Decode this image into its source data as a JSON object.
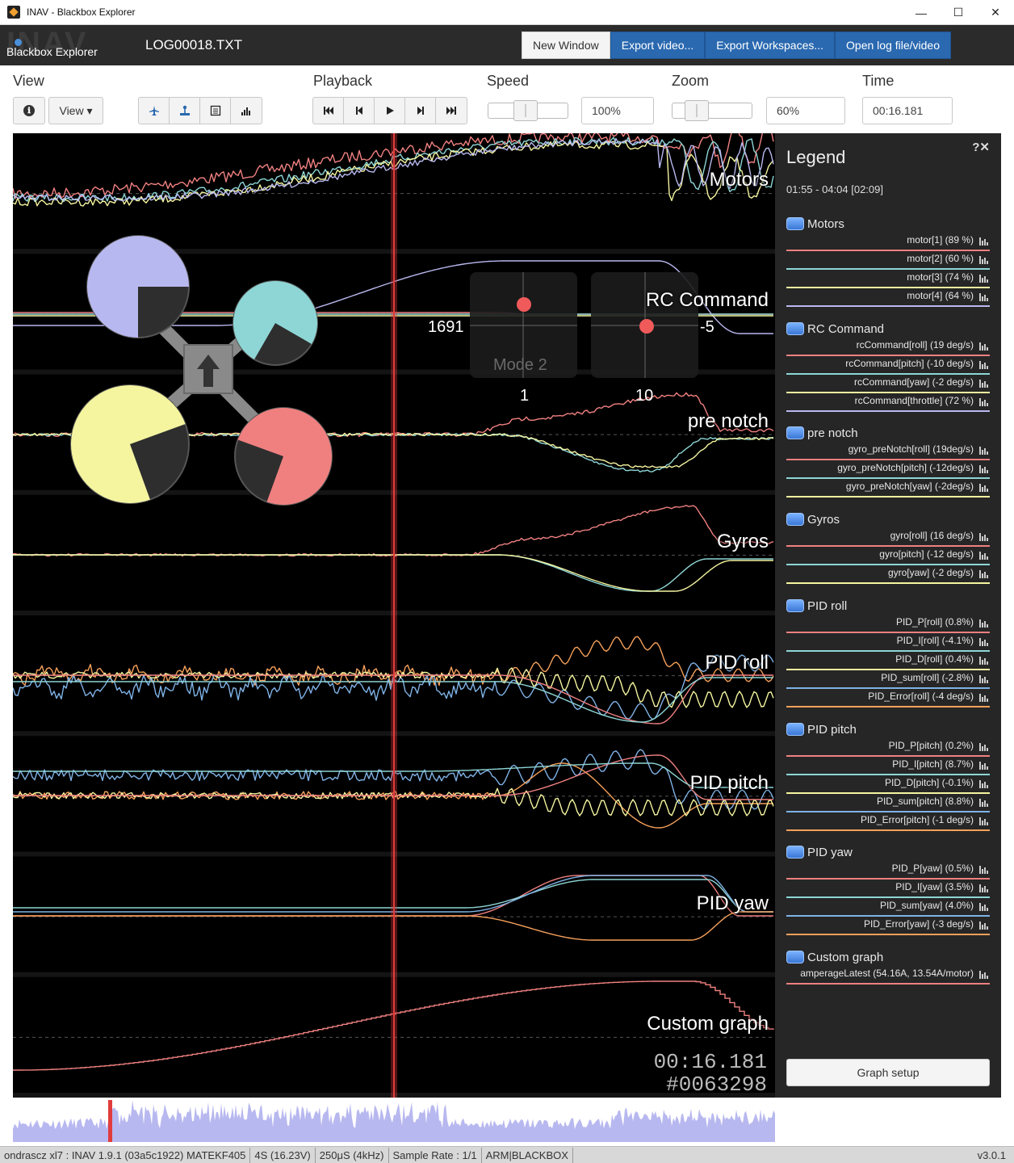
{
  "window": {
    "title": "INAV - Blackbox Explorer",
    "minimize": "—",
    "maximize": "☐",
    "close": "✕"
  },
  "header": {
    "logo_text": "INAV",
    "logo_sub": "Blackbox Explorer",
    "filename": "LOG00018.TXT",
    "buttons": {
      "new_window": "New Window",
      "export_video": "Export video...",
      "export_workspaces": "Export Workspaces...",
      "open_log": "Open log file/video"
    }
  },
  "toolbar": {
    "view_label": "View",
    "info_icon": "ℹ",
    "view_button": "View ▾",
    "playback_label": "Playback",
    "speed_label": "Speed",
    "speed_value": "100%",
    "speed_fraction": 0.45,
    "zoom_label": "Zoom",
    "zoom_value": "60%",
    "zoom_fraction": 0.22,
    "time_label": "Time",
    "time_value": "00:16.181"
  },
  "graph": {
    "labels": {
      "motors": "Motors",
      "rc": "RC Command",
      "prenotch": "pre notch",
      "gyros": "Gyros",
      "pidroll": "PID roll",
      "pidpitch": "PID pitch",
      "pidyaw": "PID yaw",
      "custom": "Custom graph"
    },
    "sticks": {
      "left_value": "1691",
      "right_value": "-5",
      "left_bottom": "1",
      "right_bottom": "10",
      "mode": "Mode 2"
    },
    "time": "00:16.181",
    "frame": "#0063298"
  },
  "legend": {
    "title": "Legend",
    "close_icons": "?✕",
    "range": "01:55 - 04:04 [02:09]",
    "groups": [
      {
        "name": "Motors",
        "items": [
          {
            "label": "motor[1] (89 %)",
            "color": "#f08080"
          },
          {
            "label": "motor[2] (60 %)",
            "color": "#8ed6d6"
          },
          {
            "label": "motor[3] (74 %)",
            "color": "#f5f5a0"
          },
          {
            "label": "motor[4] (64 %)",
            "color": "#b8b8f0"
          }
        ]
      },
      {
        "name": "RC Command",
        "items": [
          {
            "label": "rcCommand[roll] (19 deg/s)",
            "color": "#f08080"
          },
          {
            "label": "rcCommand[pitch] (-10 deg/s)",
            "color": "#8ed6d6"
          },
          {
            "label": "rcCommand[yaw] (-2 deg/s)",
            "color": "#f5f5a0"
          },
          {
            "label": "rcCommand[throttle] (72 %)",
            "color": "#b8b8f0"
          }
        ]
      },
      {
        "name": "pre notch",
        "items": [
          {
            "label": "gyro_preNotch[roll] (19deg/s)",
            "color": "#f08080"
          },
          {
            "label": "gyro_preNotch[pitch] (-12deg/s)",
            "color": "#8ed6d6"
          },
          {
            "label": "gyro_preNotch[yaw] (-2deg/s)",
            "color": "#f5f5a0"
          }
        ]
      },
      {
        "name": "Gyros",
        "items": [
          {
            "label": "gyro[roll] (16 deg/s)",
            "color": "#f08080"
          },
          {
            "label": "gyro[pitch] (-12 deg/s)",
            "color": "#8ed6d6"
          },
          {
            "label": "gyro[yaw] (-2 deg/s)",
            "color": "#f5f5a0"
          }
        ]
      },
      {
        "name": "PID roll",
        "items": [
          {
            "label": "PID_P[roll] (0.8%)",
            "color": "#f08080"
          },
          {
            "label": "PID_I[roll] (-4.1%)",
            "color": "#8ed6d6"
          },
          {
            "label": "PID_D[roll] (0.4%)",
            "color": "#f5f5a0"
          },
          {
            "label": "PID_sum[roll] (-2.8%)",
            "color": "#7fb2e6"
          },
          {
            "label": "PID_Error[roll] (-4 deg/s)",
            "color": "#f5a05a"
          }
        ]
      },
      {
        "name": "PID pitch",
        "items": [
          {
            "label": "PID_P[pitch] (0.2%)",
            "color": "#f08080"
          },
          {
            "label": "PID_I[pitch] (8.7%)",
            "color": "#8ed6d6"
          },
          {
            "label": "PID_D[pitch] (-0.1%)",
            "color": "#f5f5a0"
          },
          {
            "label": "PID_sum[pitch] (8.8%)",
            "color": "#7fb2e6"
          },
          {
            "label": "PID_Error[pitch] (-1 deg/s)",
            "color": "#f5a05a"
          }
        ]
      },
      {
        "name": "PID yaw",
        "items": [
          {
            "label": "PID_P[yaw] (0.5%)",
            "color": "#f08080"
          },
          {
            "label": "PID_I[yaw] (3.5%)",
            "color": "#8ed6d6"
          },
          {
            "label": "PID_sum[yaw] (4.0%)",
            "color": "#7fb2e6"
          },
          {
            "label": "PID_Error[yaw] (-3 deg/s)",
            "color": "#f5a05a"
          }
        ]
      },
      {
        "name": "Custom graph",
        "items": [
          {
            "label": "amperageLatest (54.16A, 13.54A/motor)",
            "color": "#f08080"
          }
        ]
      }
    ],
    "graph_setup": "Graph setup"
  },
  "status": {
    "segments": [
      "ondrascz xl7 : INAV 1.9.1 (03a5c1922) MATEKF405",
      "4S (16.23V)",
      "250μS (4kHz)",
      "Sample Rate : 1/1",
      "ARM|BLACKBOX"
    ],
    "version": "v3.0.1"
  },
  "colors": {
    "accent": "#2a69b0",
    "cursor": "#e03c3c",
    "motor1": "#f08080",
    "motor2": "#8ed6d6",
    "motor3": "#f5f5a0",
    "motor4": "#b8b8f0",
    "seek": "#b8b8f0"
  }
}
